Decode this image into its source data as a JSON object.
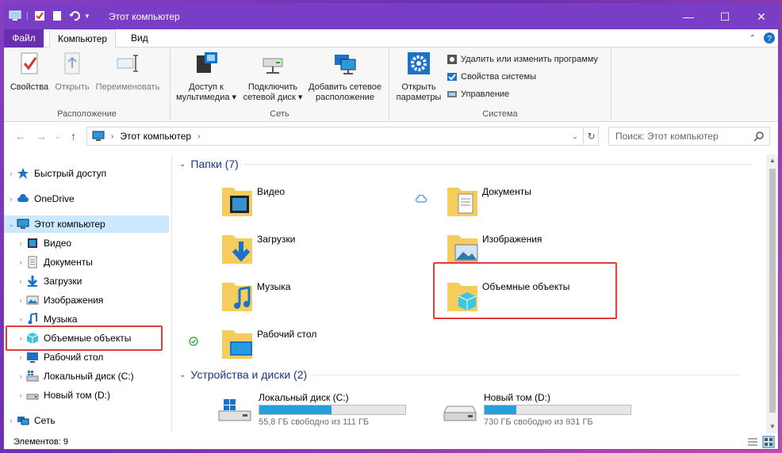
{
  "window": {
    "title": "Этот компьютер"
  },
  "ribbon_tabs": {
    "file": "Файл",
    "computer": "Компьютер",
    "view": "Вид"
  },
  "ribbon": {
    "location": {
      "name": "Расположение",
      "properties": "Свойства",
      "open": "Открыть",
      "rename": "Переименовать"
    },
    "network": {
      "name": "Сеть",
      "media_line1": "Доступ к",
      "media_line2": "мультимедиа",
      "drive_line1": "Подключить",
      "drive_line2": "сетевой диск",
      "addloc_line1": "Добавить сетевое",
      "addloc_line2": "расположение"
    },
    "system": {
      "name": "Система",
      "settings_line1": "Открыть",
      "settings_line2": "параметры",
      "uninstall": "Удалить или изменить программу",
      "sysprops": "Свойства системы",
      "manage": "Управление"
    }
  },
  "address": {
    "path": "Этот компьютер",
    "search_placeholder": "Поиск: Этот компьютер"
  },
  "nav": [
    {
      "label": "Быстрый доступ"
    },
    {
      "label": "OneDrive"
    },
    {
      "label": "Этот компьютер"
    },
    {
      "label": "Видео"
    },
    {
      "label": "Документы"
    },
    {
      "label": "Загрузки"
    },
    {
      "label": "Изображения"
    },
    {
      "label": "Музыка"
    },
    {
      "label": "Объемные объекты"
    },
    {
      "label": "Рабочий стол"
    },
    {
      "label": "Локальный диск (C:)"
    },
    {
      "label": "Новый том (D:)"
    },
    {
      "label": "Сеть"
    }
  ],
  "folders_group": "Папки (7)",
  "folders": [
    {
      "name": "Видео"
    },
    {
      "name": "Документы"
    },
    {
      "name": "Загрузки"
    },
    {
      "name": "Изображения"
    },
    {
      "name": "Музыка"
    },
    {
      "name": "Объемные объекты"
    },
    {
      "name": "Рабочий стол"
    }
  ],
  "drives_group": "Устройства и диски (2)",
  "drives": [
    {
      "name": "Локальный диск (C:)",
      "free_text": "55,8 ГБ свободно из 111 ГБ",
      "used_fraction": 0.497
    },
    {
      "name": "Новый том (D:)",
      "free_text": "730 ГБ свободно из 931 ГБ",
      "used_fraction": 0.216
    }
  ],
  "status": {
    "items": "Элементов: 9"
  },
  "colors": {
    "titlebar": "#7a3ec6",
    "file_tab": "#6a2fb0",
    "selection": "#cce8ff",
    "highlight_box": "#e03c3c",
    "bar_fill": "#26a0da"
  }
}
